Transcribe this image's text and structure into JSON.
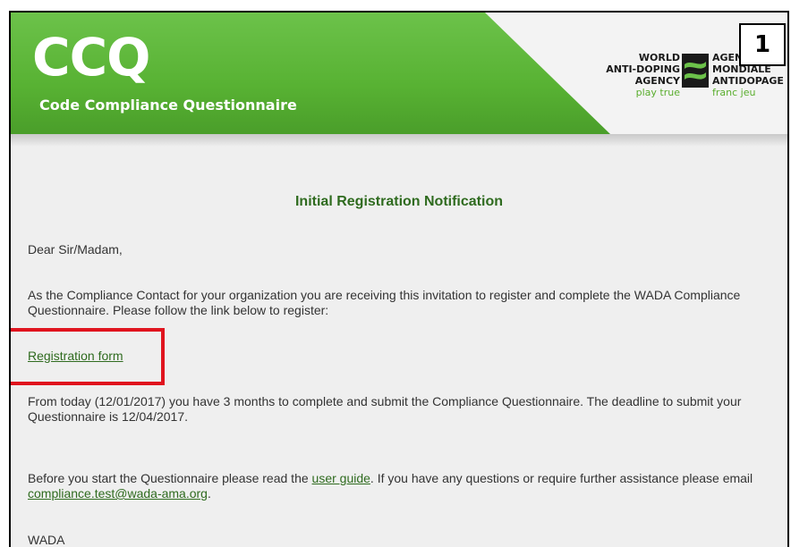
{
  "header": {
    "title": "CCQ",
    "subtitle": "Code Compliance Questionnaire"
  },
  "logo": {
    "left_lines": [
      "WORLD",
      "ANTI-DOPING",
      "AGENCY"
    ],
    "left_tag": "play true",
    "right_lines": [
      "AGENCE",
      "MONDIALE",
      "ANTIDOPAGE"
    ],
    "right_tag": "franc jeu"
  },
  "badge": "1",
  "email": {
    "title": "Initial Registration Notification",
    "greeting": "Dear Sir/Madam,",
    "intro": "As the Compliance Contact for your organization you are receiving this invitation to register and complete the WADA Compliance Questionnaire. Please follow the link below to register:",
    "registration_link": "Registration form",
    "deadline": "From today (12/01/2017) you have 3 months to complete and submit the Compliance Questionnaire. The deadline to submit your Questionnaire is 12/04/2017.",
    "guide_prefix": "Before you start the Questionnaire please read the ",
    "guide_link": "user guide",
    "guide_middle": ". If you have any questions or require further assistance please email ",
    "contact_email": "compliance.test@wada-ama.org",
    "guide_suffix": ".",
    "signature": "WADA"
  },
  "colors": {
    "brand_green": "#58b233",
    "link_green": "#2f6b1f",
    "highlight_red": "#e0141e"
  }
}
